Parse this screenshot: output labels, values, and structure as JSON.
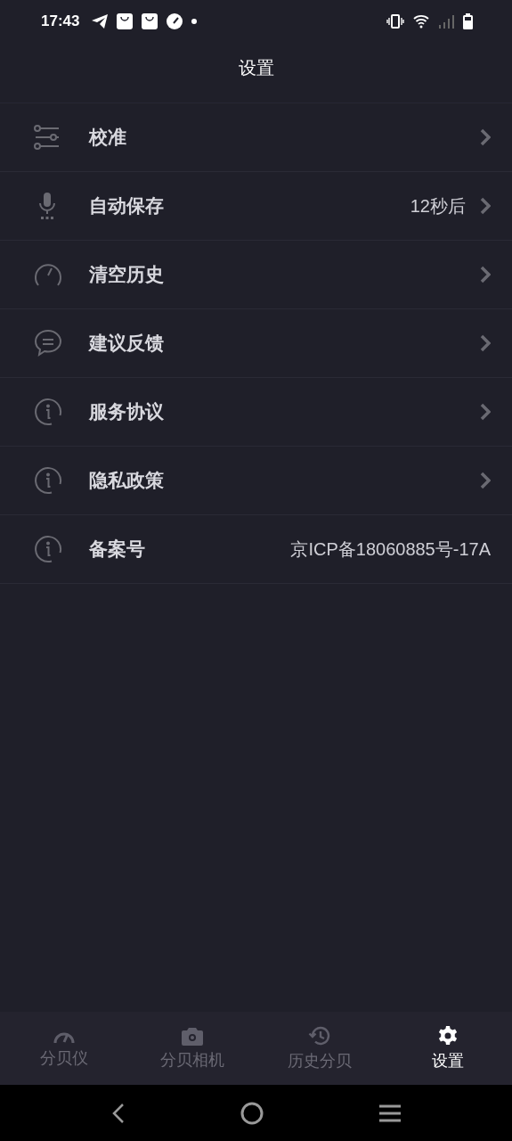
{
  "status_bar": {
    "time": "17:43"
  },
  "header": {
    "title": "设置"
  },
  "settings": [
    {
      "label": "校准",
      "chevron": true
    },
    {
      "label": "自动保存",
      "value": "12秒后",
      "chevron": true
    },
    {
      "label": "清空历史",
      "chevron": true
    },
    {
      "label": "建议反馈",
      "chevron": true
    },
    {
      "label": "服务协议",
      "chevron": true
    },
    {
      "label": "隐私政策",
      "chevron": true
    },
    {
      "label": "备案号",
      "value": "京ICP备18060885号-17A",
      "chevron": false
    }
  ],
  "tabs": [
    {
      "label": "分贝仪",
      "selected": false
    },
    {
      "label": "分贝相机",
      "selected": false
    },
    {
      "label": "历史分贝",
      "selected": false
    },
    {
      "label": "设置",
      "selected": true
    }
  ]
}
